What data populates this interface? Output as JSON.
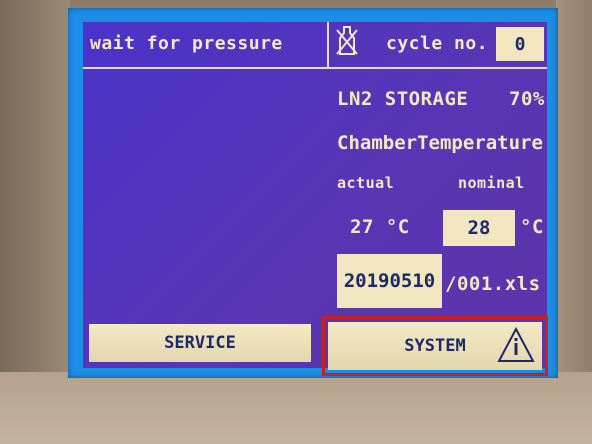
{
  "header": {
    "status": "wait for pressure",
    "icon": "no-bottle-icon",
    "cycle_label": "cycle no.",
    "cycle_value": "0"
  },
  "storage": {
    "label": "LN2 STORAGE",
    "percent": "70%"
  },
  "chamber": {
    "title": "ChamberTemperature",
    "actual_label": "actual",
    "nominal_label": "nominal",
    "actual_value": "27 °C",
    "nominal_value": "28",
    "nominal_unit": "°C"
  },
  "file": {
    "date": "20190510",
    "suffix": "/001.xls"
  },
  "buttons": {
    "service": "SERVICE",
    "system": "SYSTEM",
    "info_icon": "warning-info-icon"
  },
  "colors": {
    "panel_bg": "#4a33c9",
    "text": "#f4e8c4",
    "button_bg": "#f2e6c0",
    "button_text": "#1c2a6a",
    "highlight": "#c8201e"
  }
}
